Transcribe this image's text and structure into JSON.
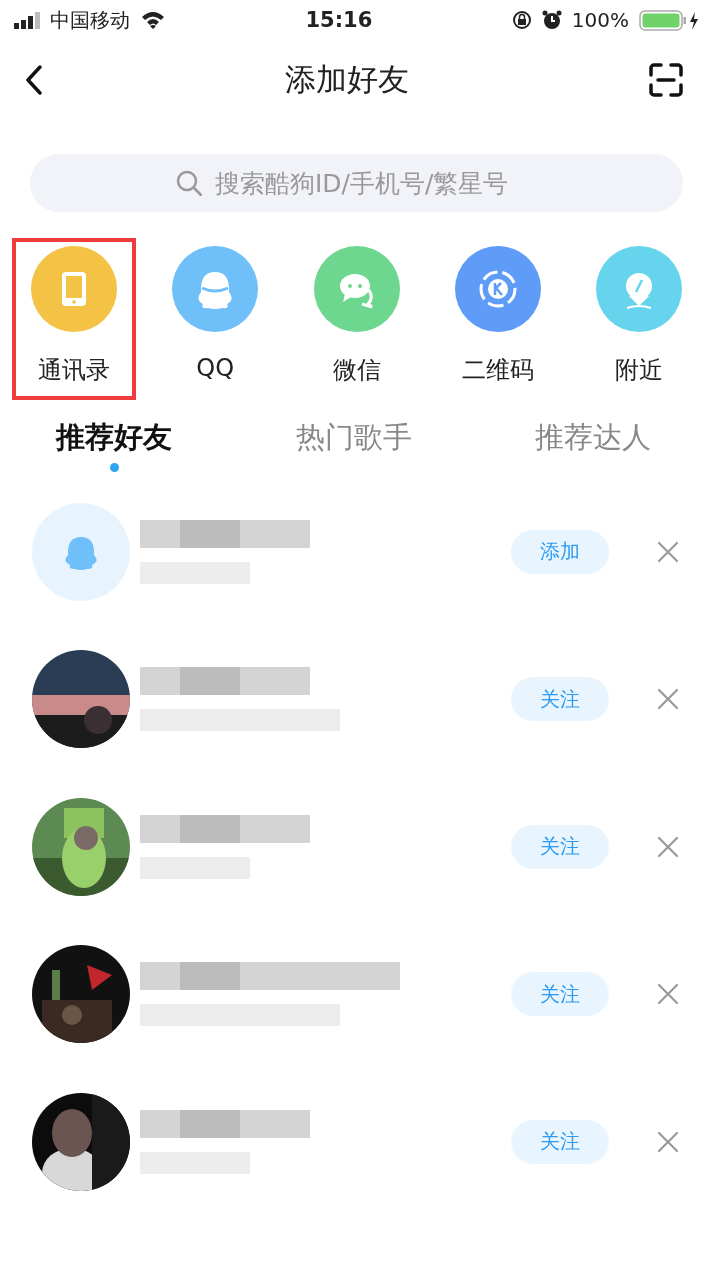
{
  "status_bar": {
    "carrier": "中国移动",
    "time": "15:16",
    "battery": "100%"
  },
  "header": {
    "title": "添加好友"
  },
  "search": {
    "placeholder": "搜索酷狗ID/手机号/繁星号"
  },
  "shortcuts": [
    {
      "label": "通讯录",
      "kind": "contacts",
      "color": "#f4c244",
      "highlighted": true
    },
    {
      "label": "QQ",
      "kind": "qq",
      "color": "#6fbff9",
      "highlighted": false
    },
    {
      "label": "微信",
      "kind": "wechat",
      "color": "#6dd68f",
      "highlighted": false
    },
    {
      "label": "二维码",
      "kind": "qrcode",
      "color": "#5f9cf8",
      "highlighted": false
    },
    {
      "label": "附近",
      "kind": "nearby",
      "color": "#66d4ec",
      "highlighted": false
    }
  ],
  "tabs": [
    {
      "label": "推荐好友",
      "selected": true
    },
    {
      "label": "热门歌手",
      "selected": false
    },
    {
      "label": "推荐达人",
      "selected": false
    }
  ],
  "friends": [
    {
      "kind": "qq",
      "action": "添加"
    },
    {
      "kind": "picture",
      "action": "关注"
    },
    {
      "kind": "picture",
      "action": "关注"
    },
    {
      "kind": "picture",
      "action": "关注"
    },
    {
      "kind": "picture",
      "action": "关注"
    }
  ]
}
